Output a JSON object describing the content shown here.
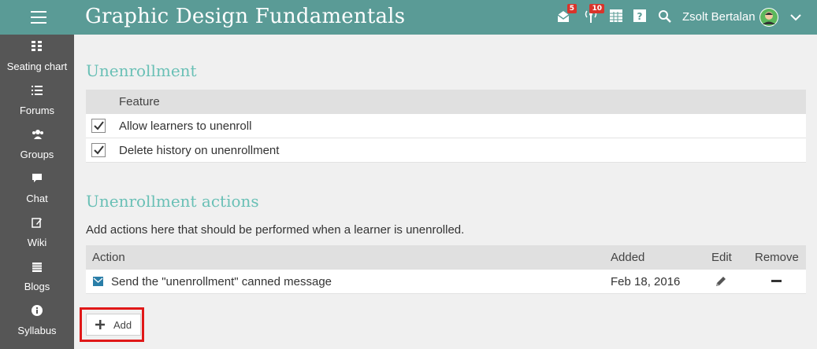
{
  "header": {
    "title": "Graphic Design Fundamentals",
    "user_name": "Zsolt Bertalan",
    "messages_badge": "5",
    "notifications_badge": "10",
    "bg_color": "#5a9b96"
  },
  "sidebar": {
    "items": [
      {
        "label": "Seating chart",
        "icon": "seating-chart-icon"
      },
      {
        "label": "Forums",
        "icon": "list-icon"
      },
      {
        "label": "Groups",
        "icon": "group-icon"
      },
      {
        "label": "Chat",
        "icon": "chat-icon"
      },
      {
        "label": "Wiki",
        "icon": "edit-icon"
      },
      {
        "label": "Blogs",
        "icon": "calendar-icon"
      },
      {
        "label": "Syllabus",
        "icon": "info-icon"
      }
    ]
  },
  "unenrollment": {
    "heading": "Unenrollment",
    "column_feature": "Feature",
    "rows": [
      {
        "label": "Allow learners to unenroll",
        "checked": true
      },
      {
        "label": "Delete history on unenrollment",
        "checked": true
      }
    ]
  },
  "actions": {
    "heading": "Unenrollment actions",
    "description": "Add actions here that should be performed when a learner is unenrolled.",
    "columns": {
      "action": "Action",
      "added": "Added",
      "edit": "Edit",
      "remove": "Remove"
    },
    "rows": [
      {
        "action": "Send the \"unenrollment\" canned message",
        "added": "Feb 18, 2016"
      }
    ],
    "add_label": "Add"
  },
  "colors": {
    "accent_heading": "#6ac0b6",
    "sidebar_bg": "#565656",
    "highlight": "#e01818"
  }
}
